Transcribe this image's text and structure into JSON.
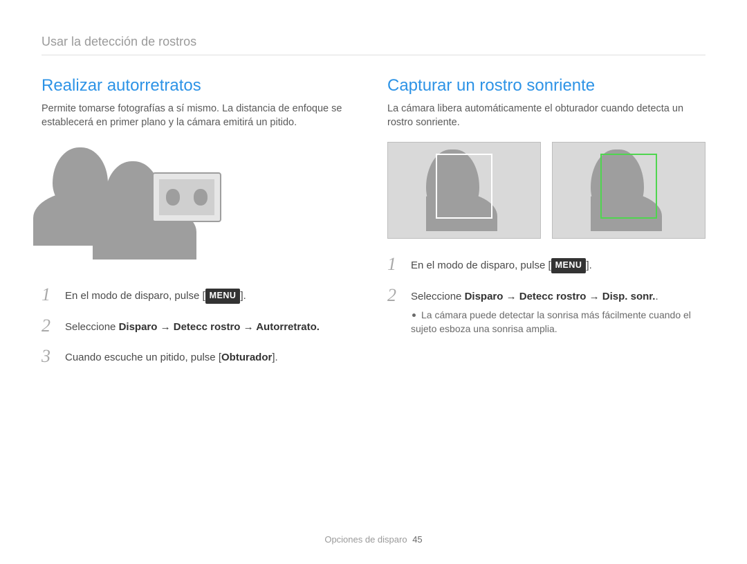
{
  "breadcrumb": "Usar la detección de rostros",
  "left": {
    "heading": "Realizar autorretratos",
    "desc": "Permite tomarse fotografías a sí mismo. La distancia de enfoque se establecerá en primer plano y la cámara emitirá un pitido.",
    "steps": [
      {
        "num": "1",
        "pre": "En el modo de disparo, pulse [",
        "badge": "MENU",
        "post": "]."
      },
      {
        "num": "2",
        "plain_pre": "Seleccione ",
        "bold": "Disparo → Detecc rostro → Autorretrato.",
        "plain_post": ""
      },
      {
        "num": "3",
        "plain_pre": "Cuando escuche un pitido, pulse [",
        "bold": "Obturador",
        "plain_post": "]."
      }
    ]
  },
  "right": {
    "heading": "Capturar un rostro sonriente",
    "desc": "La cámara libera automáticamente el obturador cuando detecta un rostro sonriente.",
    "steps": [
      {
        "num": "1",
        "pre": "En el modo de disparo, pulse [",
        "badge": "MENU",
        "post": "]."
      },
      {
        "num": "2",
        "plain_pre": "Seleccione ",
        "bold": "Disparo → Detecc rostro → Disp. sonr.",
        "plain_post": ".",
        "sub": "La cámara puede detectar la sonrisa más fácilmente cuando el sujeto esboza una sonrisa amplia."
      }
    ]
  },
  "footer": {
    "label": "Opciones de disparo",
    "page": "45"
  }
}
